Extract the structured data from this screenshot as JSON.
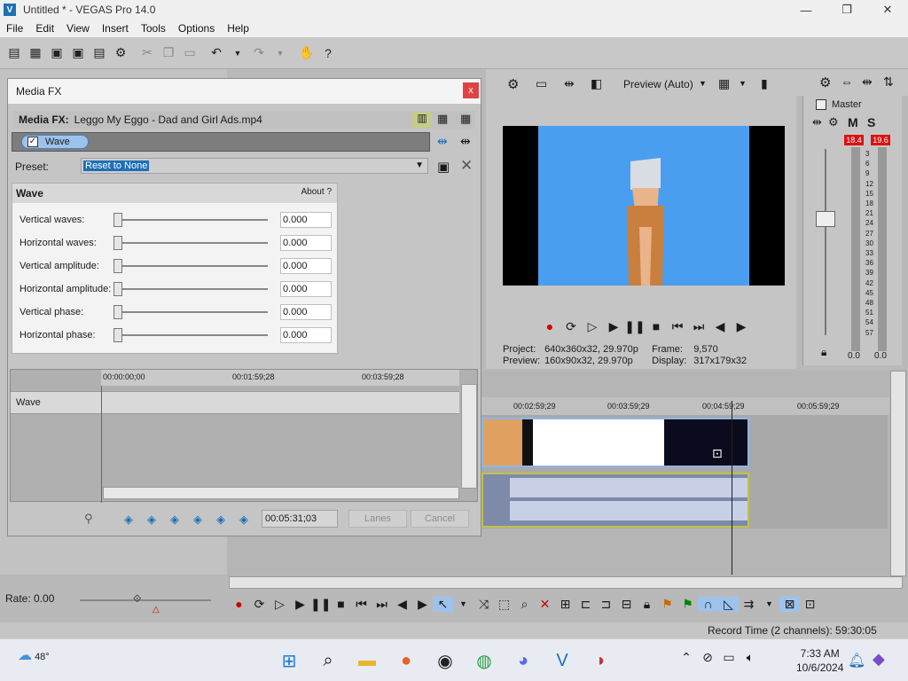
{
  "window": {
    "title": "Untitled * - VEGAS Pro 14.0",
    "minimize": "—",
    "restore": "❐",
    "close": "✕"
  },
  "menu": [
    "File",
    "Edit",
    "View",
    "Insert",
    "Tools",
    "Options",
    "Help"
  ],
  "preview": {
    "mode_label": "Preview (Auto)",
    "project_label": "Project:",
    "project_value": "640x360x32, 29.970p",
    "preview_label": "Preview:",
    "preview_value": "160x90x32, 29.970p",
    "frame_label": "Frame:",
    "frame_value": "9,570",
    "display_label": "Display:",
    "display_value": "317x179x32"
  },
  "master": {
    "title": "Master",
    "mute": "M",
    "solo": "S",
    "peak_left": "18.4",
    "peak_right": "19.6",
    "scale": [
      "3",
      "6",
      "9",
      "12",
      "15",
      "18",
      "21",
      "24",
      "27",
      "30",
      "33",
      "36",
      "39",
      "42",
      "45",
      "48",
      "51",
      "54",
      "57"
    ],
    "bottom_left": "0.0",
    "bottom_right": "0.0"
  },
  "dialog": {
    "title": "Media FX",
    "close": "x",
    "fx_label": "Media FX:",
    "fx_name": "Leggo My Eggo - Dad and Girl Ads.mp4",
    "chain_item": "Wave",
    "preset_label": "Preset:",
    "preset_value": "Reset to None",
    "panel_title": "Wave",
    "about_label": "About",
    "about_q": "?",
    "params": [
      {
        "label": "Vertical waves:",
        "value": "0.000"
      },
      {
        "label": "Horizontal waves:",
        "value": "0.000"
      },
      {
        "label": "Vertical amplitude:",
        "value": "0.000"
      },
      {
        "label": "Horizontal amplitude:",
        "value": "0.000"
      },
      {
        "label": "Vertical phase:",
        "value": "0.000"
      },
      {
        "label": "Horizontal phase:",
        "value": "0.000"
      }
    ],
    "kf_ruler": [
      "00:00:00;00",
      "00:01:59;28",
      "00:03:59;28"
    ],
    "kf_row_label": "Wave",
    "time_value": "00:05:31;03",
    "btn_lanes": "Lanes",
    "btn_cancel": "Cancel"
  },
  "timeline": {
    "ruler": [
      "00:02:59;29",
      "00:03:59;29",
      "00:04:59;29",
      "00:05:59;29"
    ]
  },
  "rate_label": "Rate: 0.00",
  "status": {
    "record_time": "Record Time (2 channels): 59:30:05"
  },
  "taskbar": {
    "temperature": "48°",
    "time": "7:33 AM",
    "date": "10/6/2024"
  }
}
